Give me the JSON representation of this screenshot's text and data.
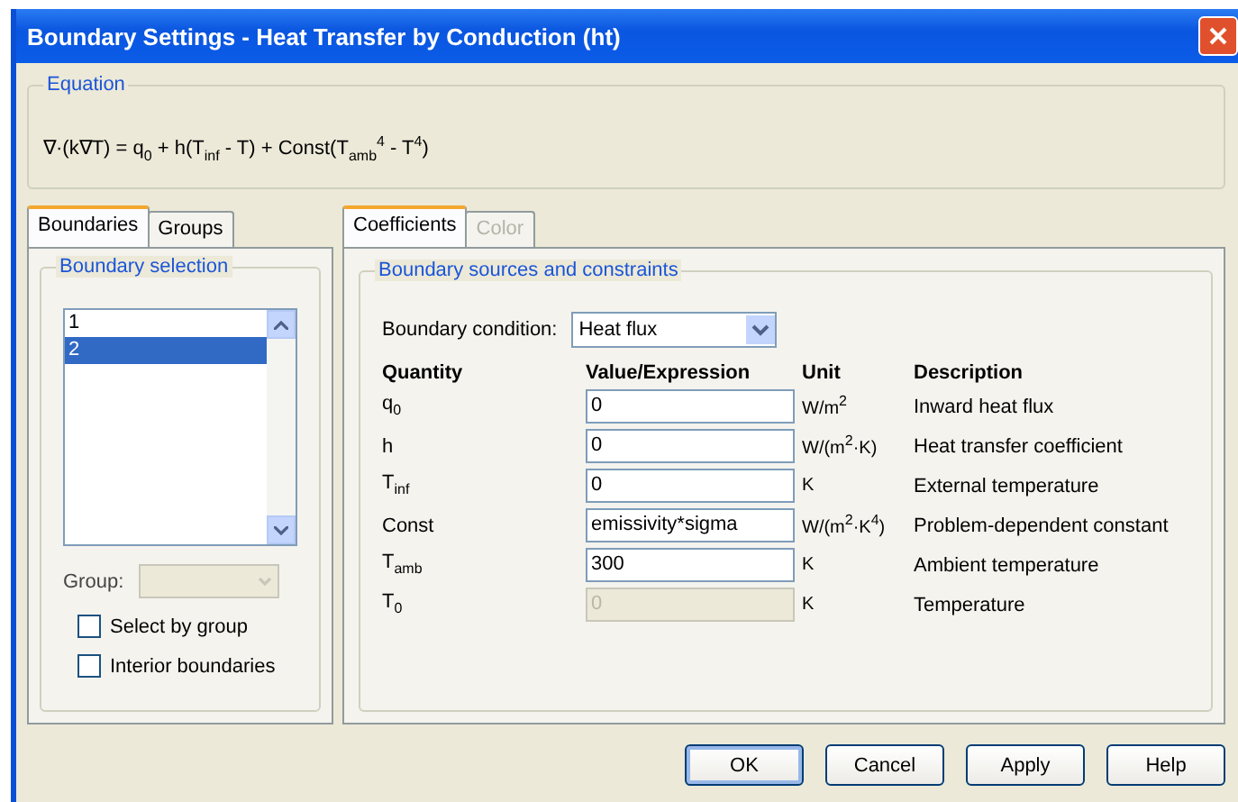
{
  "window": {
    "title": "Boundary Settings - Heat Transfer by Conduction (ht)"
  },
  "equation": {
    "label": "Equation",
    "formula": "∇·(k∇T) = q$_{0}$ + h(T$_{inf}$ - T) + Const(T$_{amb}$$^{4}$ - T$^{4}$)"
  },
  "left_tabs": [
    {
      "label": "Boundaries",
      "selected": true
    },
    {
      "label": "Groups",
      "selected": false
    }
  ],
  "boundary_selection": {
    "label": "Boundary selection",
    "items": [
      {
        "label": "1",
        "selected": false
      },
      {
        "label": "2",
        "selected": true
      }
    ],
    "group": {
      "label": "Group:",
      "disabled": true
    },
    "checkboxes": [
      {
        "label": "Select by group",
        "checked": false
      },
      {
        "label": "Interior boundaries",
        "checked": false
      }
    ]
  },
  "right_tabs": [
    {
      "label": "Coefficients",
      "selected": true,
      "disabled": false
    },
    {
      "label": "Color",
      "selected": false,
      "disabled": true
    }
  ],
  "sources": {
    "label": "Boundary sources and constraints",
    "condition": {
      "label": "Boundary condition:",
      "value": "Heat flux"
    },
    "columns": [
      "Quantity",
      "Value/Expression",
      "Unit",
      "Description"
    ],
    "rows": [
      {
        "quantity": "q$_{0}$",
        "value": "0",
        "disabled": false,
        "unit": "W/m$^{2}$",
        "description": "Inward heat flux"
      },
      {
        "quantity": "h",
        "value": "0",
        "disabled": false,
        "unit": "W/(m$^{2}$·K)",
        "description": "Heat transfer coefficient"
      },
      {
        "quantity": "T$_{inf}$",
        "value": "0",
        "disabled": false,
        "unit": "K",
        "description": "External temperature"
      },
      {
        "quantity": "Const",
        "value": "emissivity*sigma",
        "disabled": false,
        "unit": "W/(m$^{2}$·K$^{4}$)",
        "description": "Problem-dependent constant"
      },
      {
        "quantity": "T$_{amb}$",
        "value": "300",
        "disabled": false,
        "unit": "K",
        "description": "Ambient temperature"
      },
      {
        "quantity": "T$_{0}$",
        "value": "0",
        "disabled": true,
        "unit": "K",
        "description": "Temperature"
      }
    ]
  },
  "buttons": [
    "OK",
    "Cancel",
    "Apply",
    "Help"
  ]
}
